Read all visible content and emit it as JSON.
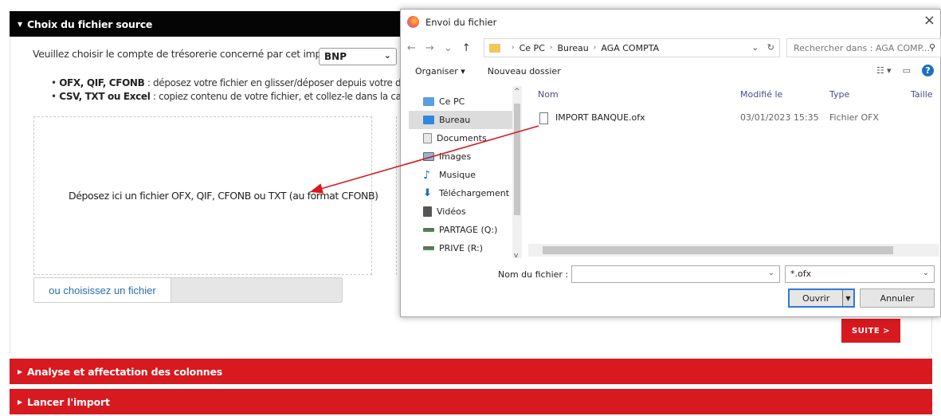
{
  "page": {
    "section1_title": "Choix du fichier source",
    "section2_title": "Analyse et affectation des colonnes",
    "section3_title": "Lancer l'import",
    "account_prompt": "Veuillez choisir le compte de trésorerie concerné par cet import :",
    "account_value": "BNP",
    "bullet1_bold": "OFX, QIF, CFONB",
    "bullet1_text": " : déposez votre fichier en glisser/déposer depuis votre disqu",
    "bullet2_bold": "CSV, TXT ou Excel",
    "bullet2_text": " : copiez contenu de votre fichier, et collez-le dans la case d",
    "drop_text": "Déposez ici un fichier OFX, QIF, CFONB ou TXT (au format CFONB)",
    "choose_file_label": "ou choisissez un fichier",
    "next_button": "SUITE >",
    "colors": {
      "black_header": "#050505",
      "red": "#d71920",
      "link": "#2a6db0"
    }
  },
  "dialog": {
    "title": "Envoi du fichier",
    "close": "×",
    "path": [
      "Ce PC",
      "Bureau",
      "AGA COMPTA"
    ],
    "search_placeholder": "Rechercher dans : AGA COMP...",
    "organize": "Organiser ▾",
    "new_folder": "Nouveau dossier",
    "tree": [
      {
        "label": "Ce PC",
        "icon": "pc-icon"
      },
      {
        "label": "Bureau",
        "icon": "desktop-icon"
      },
      {
        "label": "Documents",
        "icon": "documents-icon"
      },
      {
        "label": "Images",
        "icon": "images-icon"
      },
      {
        "label": "Musique",
        "icon": "music-icon"
      },
      {
        "label": "Téléchargement",
        "icon": "download-icon"
      },
      {
        "label": "Vidéos",
        "icon": "videos-icon"
      },
      {
        "label": "PARTAGE (Q:)",
        "icon": "drive-icon"
      },
      {
        "label": "PRIVE (R:)",
        "icon": "drive-icon"
      }
    ],
    "columns": [
      "Nom",
      "Modifié le",
      "Type",
      "Taille"
    ],
    "files": [
      {
        "name": "IMPORT BANQUE.ofx",
        "modified": "03/01/2023 15:35",
        "type": "Fichier OFX"
      }
    ],
    "file_name_label": "Nom du fichier :",
    "file_type": "*.ofx",
    "open_button": "Ouvrir",
    "cancel_button": "Annuler"
  }
}
